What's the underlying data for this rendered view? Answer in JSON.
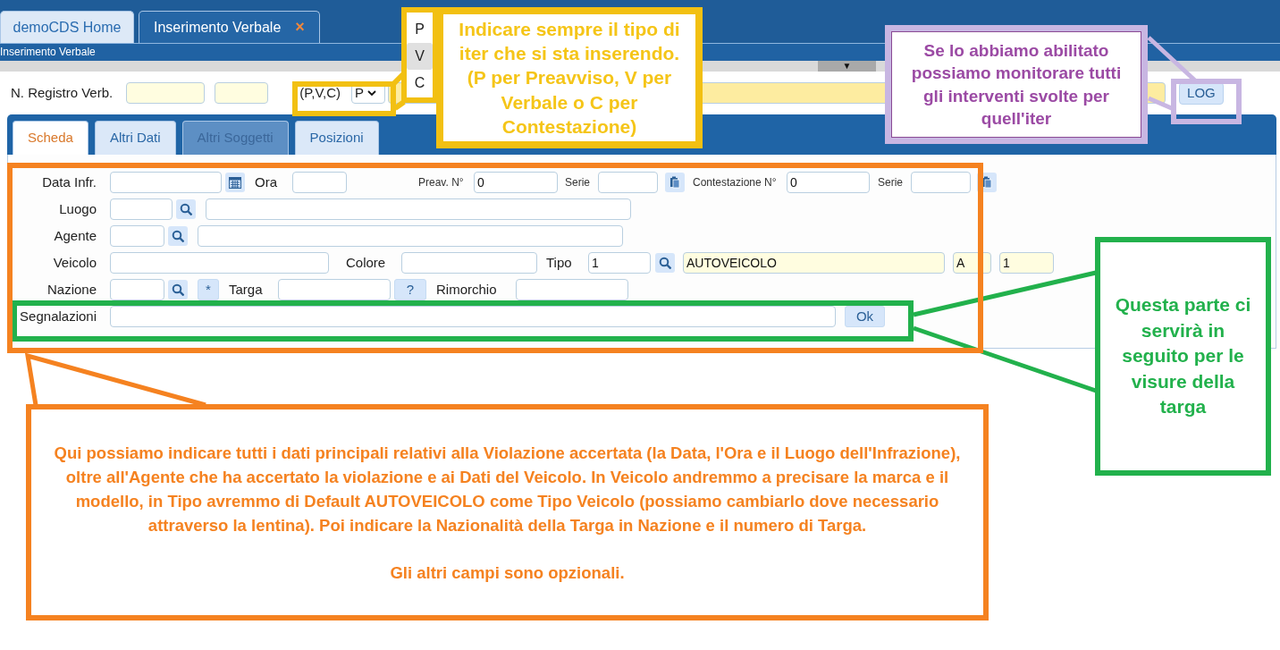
{
  "app_tabs": [
    {
      "label": "demoCDS Home",
      "selected": false
    },
    {
      "label": "Inserimento Verbale",
      "selected": true,
      "close": "×"
    }
  ],
  "page_title": "Inserimento Verbale",
  "splitter_handle": "▼",
  "header": {
    "label": "N. Registro Verb.",
    "type_label": "(P,V,C)",
    "type_value": "P",
    "log_button": "LOG",
    "type_options": [
      {
        "label": "P",
        "selected": false
      },
      {
        "label": "V",
        "selected": true
      },
      {
        "label": "C",
        "selected": false
      }
    ]
  },
  "sheet_tabs": [
    {
      "label": "Scheda",
      "selected": true,
      "disabled": false
    },
    {
      "label": "Altri Dati",
      "selected": false,
      "disabled": false
    },
    {
      "label": "Altri Soggetti",
      "selected": false,
      "disabled": true
    },
    {
      "label": "Posizioni",
      "selected": false,
      "disabled": false
    }
  ],
  "form_rows": [
    [
      {
        "kind": "label",
        "text": "Data Infr."
      },
      {
        "kind": "field"
      },
      {
        "kind": "calendar_button"
      },
      {
        "kind": "label",
        "text": "Ora"
      },
      {
        "kind": "field"
      },
      {
        "kind": "small_label",
        "text": "Preav. N°"
      },
      {
        "kind": "field",
        "value": "0"
      },
      {
        "kind": "small_label",
        "text": "Serie"
      },
      {
        "kind": "field"
      },
      {
        "kind": "copy_button"
      },
      {
        "kind": "small_label",
        "text": "Contestazione N°"
      },
      {
        "kind": "field",
        "value": "0"
      },
      {
        "kind": "small_label",
        "text": "Serie"
      },
      {
        "kind": "field"
      },
      {
        "kind": "copy_button"
      }
    ],
    [
      {
        "kind": "label",
        "text": "Luogo"
      },
      {
        "kind": "field"
      },
      {
        "kind": "search_button"
      },
      {
        "kind": "field"
      }
    ],
    [
      {
        "kind": "label",
        "text": "Agente"
      },
      {
        "kind": "field"
      },
      {
        "kind": "search_button"
      },
      {
        "kind": "field"
      }
    ],
    [
      {
        "kind": "label",
        "text": "Veicolo"
      },
      {
        "kind": "field"
      },
      {
        "kind": "label",
        "text": "Colore"
      },
      {
        "kind": "field"
      },
      {
        "kind": "label",
        "text": "Tipo"
      },
      {
        "kind": "field",
        "value": "1"
      },
      {
        "kind": "search_button"
      },
      {
        "kind": "readonly_field",
        "value": "AUTOVEICOLO"
      },
      {
        "kind": "readonly_field",
        "value": "A"
      },
      {
        "kind": "readonly_field",
        "value": "1"
      }
    ],
    [
      {
        "kind": "label",
        "text": "Nazione"
      },
      {
        "kind": "field"
      },
      {
        "kind": "search_button"
      },
      {
        "kind": "text_button",
        "text": "*"
      },
      {
        "kind": "label",
        "text": "Targa"
      },
      {
        "kind": "field"
      },
      {
        "kind": "text_button",
        "text": "?"
      },
      {
        "kind": "label",
        "text": "Rimorchio"
      },
      {
        "kind": "field"
      }
    ],
    [
      {
        "kind": "label",
        "text": "Segnalazioni"
      },
      {
        "kind": "field"
      },
      {
        "kind": "text_button",
        "text": "Ok"
      }
    ]
  ],
  "annotations": [
    {
      "color": "#f5c518",
      "paragraphs": [
        "Indicare sempre il tipo di iter che si sta inserendo. (P per Preavviso, V per Verbale o C per Contestazione)"
      ]
    },
    {
      "color": "#9b4aa4",
      "paragraphs": [
        "Se lo abbiamo abilitato possiamo monitorare tutti gli interventi svolte per quell'iter"
      ]
    },
    {
      "color": "#22b14c",
      "paragraphs": [
        "Questa parte ci servirà in seguito per le visure della targa"
      ]
    },
    {
      "color": "#f58220",
      "paragraphs": [
        "Qui possiamo indicare tutti i dati principali relativi alla Violazione accertata (la Data, l'Ora e il Luogo dell'Infrazione), oltre all'Agente che ha accertato la violazione e ai Dati del Veicolo. In Veicolo andremmo a precisare la marca e il modello, in Tipo avremmo di Default AUTOVEICOLO come Tipo Veicolo (possiamo cambiarlo dove necessario attraverso la lentina). Poi indicare la Nazionalità della Targa in Nazione e il numero di Targa.",
        "Gli altri campi sono opzionali."
      ]
    }
  ]
}
